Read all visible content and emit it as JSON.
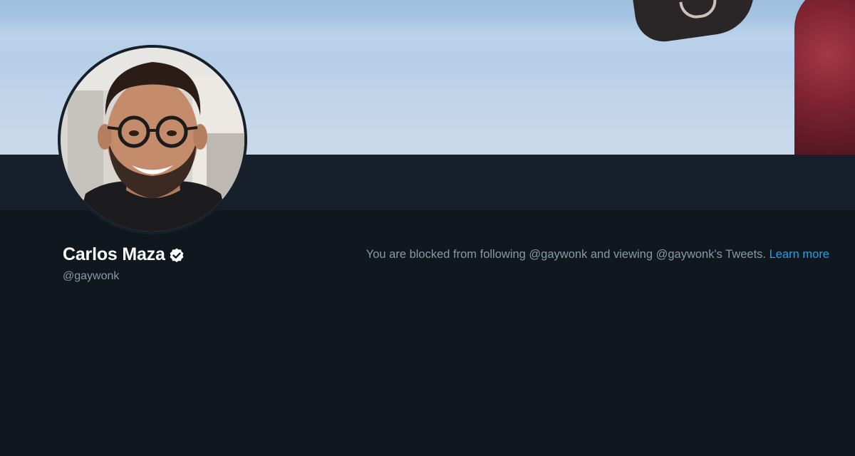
{
  "profile": {
    "name": "Carlos Maza",
    "handle": "@gaywonk",
    "verified": true,
    "avatar_icon": "profile-photo"
  },
  "blocked_notice": {
    "message": "You are blocked from following @gaywonk and viewing @gaywonk's Tweets.",
    "link_label": "Learn more"
  },
  "colors": {
    "background": "#10171e",
    "nav_strip": "#17202a",
    "link": "#1da1f2",
    "secondary_text": "#8899a6",
    "primary_text": "#ffffff"
  }
}
